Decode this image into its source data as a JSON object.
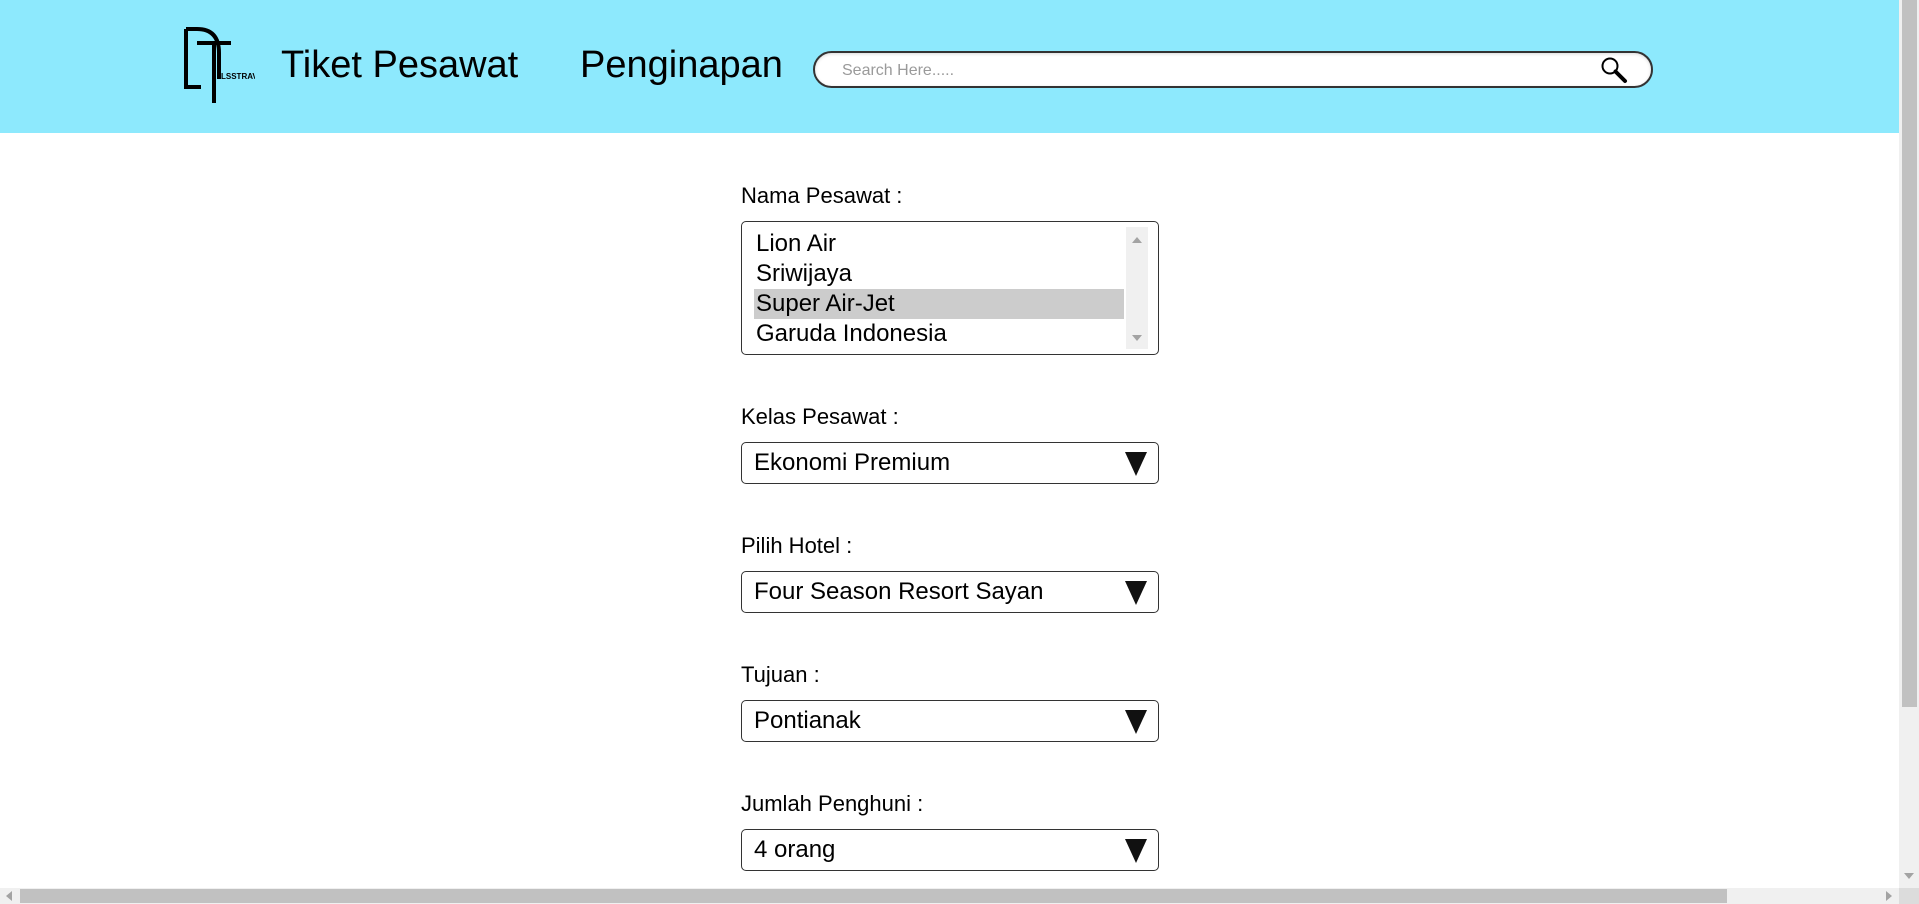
{
  "header": {
    "logo": {
      "mark_icon": "dt-monogram-logo",
      "text": "LSSTRAVEL"
    },
    "nav": [
      {
        "label": "Tiket Pesawat"
      },
      {
        "label": "Penginapan"
      }
    ],
    "search": {
      "placeholder": "Search Here.....",
      "value": "",
      "icon": "search-icon"
    },
    "background_color": "#8de9fd"
  },
  "form": {
    "nama_pesawat": {
      "label": "Nama Pesawat :",
      "options": [
        "Lion Air",
        "Sriwijaya",
        "Super Air-Jet",
        "Garuda Indonesia"
      ],
      "selected": "Super Air-Jet"
    },
    "kelas_pesawat": {
      "label": "Kelas Pesawat :",
      "value": "Ekonomi Premium"
    },
    "pilih_hotel": {
      "label": "Pilih Hotel :",
      "value": "Four Season Resort Sayan"
    },
    "tujuan": {
      "label": "Tujuan :",
      "value": "Pontianak"
    },
    "jumlah_penghuni": {
      "label": "Jumlah Penghuni :",
      "value": "4 orang"
    }
  }
}
